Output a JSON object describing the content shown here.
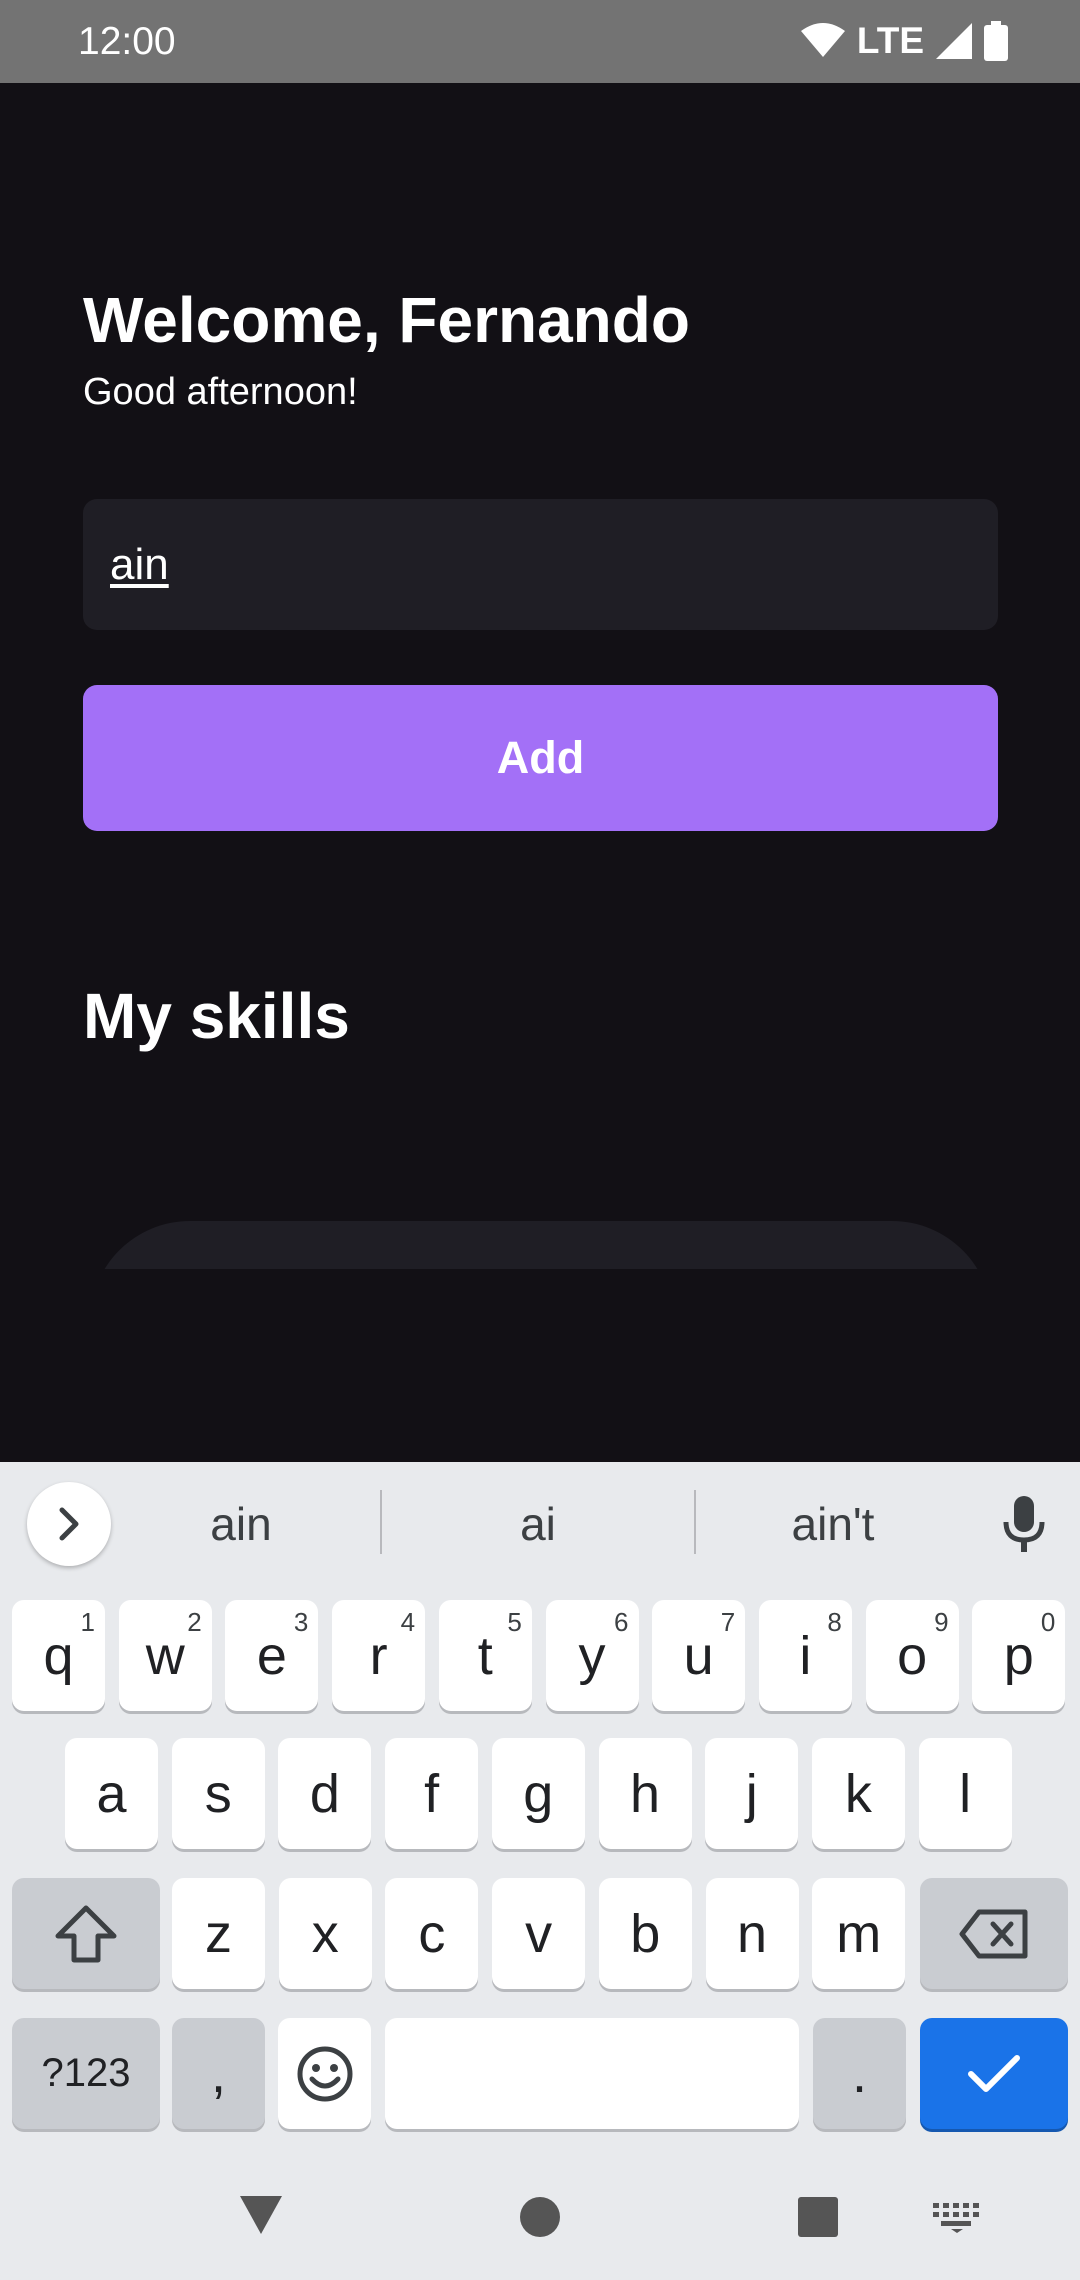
{
  "status_bar": {
    "time": "12:00",
    "network": "LTE",
    "icons": [
      "wifi-icon",
      "signal-icon",
      "battery-icon"
    ]
  },
  "app": {
    "welcome": "Welcome, Fernando",
    "greeting": "Good afternoon!",
    "input_value": "ain",
    "add_label": "Add",
    "section_title": "My skills"
  },
  "keyboard": {
    "suggestions": [
      "ain",
      "ai",
      "ain't"
    ],
    "row1": [
      {
        "k": "q",
        "h": "1"
      },
      {
        "k": "w",
        "h": "2"
      },
      {
        "k": "e",
        "h": "3"
      },
      {
        "k": "r",
        "h": "4"
      },
      {
        "k": "t",
        "h": "5"
      },
      {
        "k": "y",
        "h": "6"
      },
      {
        "k": "u",
        "h": "7"
      },
      {
        "k": "i",
        "h": "8"
      },
      {
        "k": "o",
        "h": "9"
      },
      {
        "k": "p",
        "h": "0"
      }
    ],
    "row2": [
      "a",
      "s",
      "d",
      "f",
      "g",
      "h",
      "j",
      "k",
      "l"
    ],
    "row3": [
      "z",
      "x",
      "c",
      "v",
      "b",
      "n",
      "m"
    ],
    "symbols_label": "?123",
    "comma": ",",
    "period": "."
  },
  "colors": {
    "background": "#121015",
    "accent": "#a370f7",
    "input_bg": "#1f1e25",
    "enter": "#1a73e8"
  }
}
